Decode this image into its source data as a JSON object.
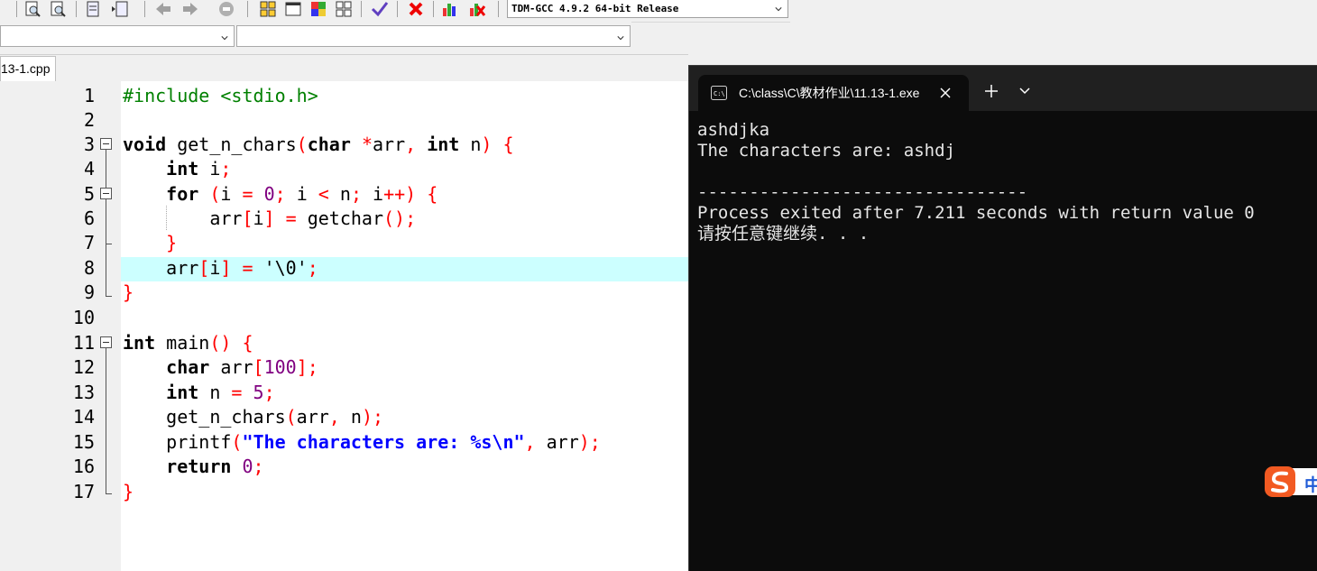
{
  "toolbar": {
    "compiler": "TDM-GCC 4.9.2 64-bit Release",
    "icons": [
      "find-icon",
      "replace-icon",
      "indent-icon",
      "unindent-icon",
      "back-icon",
      "forward-icon",
      "stop-icon",
      "grid-icon",
      "window-icon",
      "palette-icon",
      "tile-icon",
      "check-icon",
      "delete-icon",
      "chart-icon",
      "chart-delete-icon"
    ]
  },
  "combos": {
    "class": "",
    "member": ""
  },
  "tab": {
    "file_name": "13-1.cpp"
  },
  "editor": {
    "line_numbers": [
      "1",
      "2",
      "3",
      "4",
      "5",
      "6",
      "7",
      "8",
      "9",
      "10",
      "11",
      "12",
      "13",
      "14",
      "15",
      "16",
      "17"
    ],
    "highlighted_line": "8",
    "highlight_color": "#ccffff"
  },
  "terminal": {
    "title": "C:\\class\\C\\教材作业\\11.13-1.exe",
    "lines": [
      "ashdjka",
      "The characters are: ashdj",
      "",
      "--------------------------------",
      "Process exited after 7.211 seconds with return value 0",
      "请按任意键继续. . ."
    ],
    "background": "#0c0c0c"
  },
  "ime": {
    "label": "中"
  }
}
